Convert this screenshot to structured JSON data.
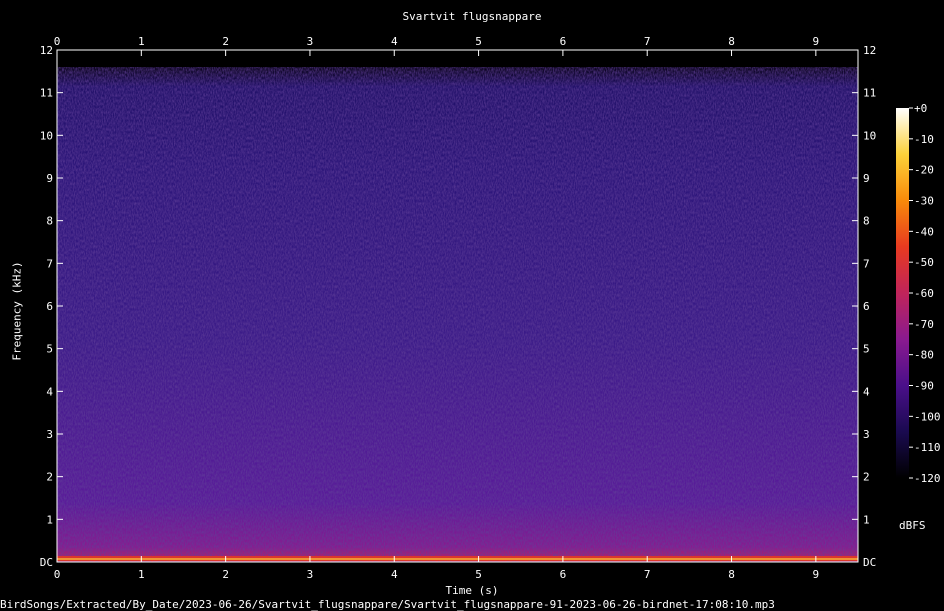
{
  "chart_data": {
    "type": "heatmap",
    "title": "Svartvit flugsnappare",
    "xlabel": "Time (s)",
    "ylabel": "Frequency (kHz)",
    "xlim": [
      0,
      9.5
    ],
    "ylim": [
      0,
      12
    ],
    "x_ticks": [
      "0",
      "1",
      "2",
      "3",
      "4",
      "5",
      "6",
      "7",
      "8",
      "9"
    ],
    "y_ticks": [
      "DC",
      "1",
      "2",
      "3",
      "4",
      "5",
      "6",
      "7",
      "8",
      "9",
      "10",
      "11",
      "12"
    ],
    "colorbar": {
      "unit": "dBFS",
      "range": [
        -120,
        0
      ],
      "ticks": [
        "+0",
        "-10",
        "-20",
        "-30",
        "-40",
        "-50",
        "-60",
        "-70",
        "-80",
        "-90",
        "-100",
        "-110",
        "-120"
      ],
      "colors": [
        "#000000",
        "#1a0a50",
        "#4a0f8a",
        "#8a1a8f",
        "#c0245a",
        "#e83a20",
        "#f88a0a",
        "#fcd23a",
        "#ffffff"
      ]
    },
    "colors": {
      "background": "#000000",
      "noise_floor": "#3a1a8a",
      "text": "#ffffff"
    }
  },
  "footer": "BirdSongs/Extracted/By_Date/2023-06-26/Svartvit_flugsnappare/Svartvit_flugsnappare-91-2023-06-26-birdnet-17:08:10.mp3"
}
